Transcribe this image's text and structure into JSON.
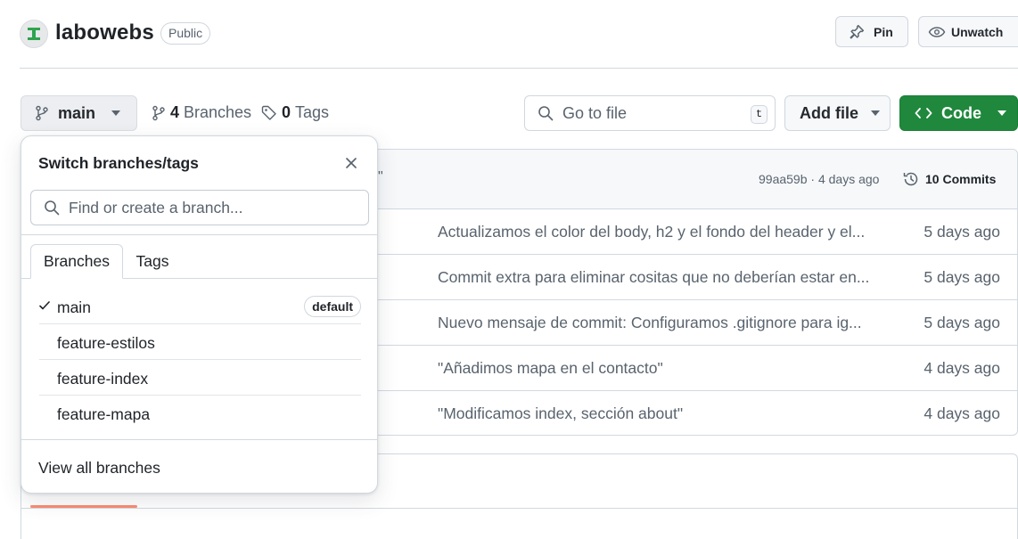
{
  "repo": {
    "name": "labowebs",
    "visibility": "Public",
    "pin_label": "Pin",
    "watch_label": "Unwatch"
  },
  "toolbar": {
    "branch": "main",
    "branches_count": "4",
    "branches_label": "Branches",
    "tags_count": "0",
    "tags_label": "Tags",
    "goto_placeholder": "Go to file",
    "goto_shortcut": "t",
    "add_file_label": "Add file",
    "code_label": "Code"
  },
  "latest_commit": {
    "quote_fragment": "\"",
    "meta": "99aa59b · 4 days ago",
    "commits_label": "10 Commits"
  },
  "files": [
    {
      "message": "Actualizamos el color del body, h2 y el fondo del header y el...",
      "time": "5 days ago"
    },
    {
      "message": "Commit extra para eliminar cositas que no deberían estar en...",
      "time": "5 days ago"
    },
    {
      "message": "Nuevo mensaje de commit: Configuramos .gitignore para ig...",
      "time": "5 days ago"
    },
    {
      "message": "\"Añadimos mapa en el contacto\"",
      "time": "4 days ago"
    },
    {
      "message": "\"Modificamos index, sección about\"",
      "time": "4 days ago"
    }
  ],
  "dropdown": {
    "title": "Switch branches/tags",
    "search_placeholder": "Find or create a branch...",
    "tabs": [
      {
        "label": "Branches"
      },
      {
        "label": "Tags"
      }
    ],
    "branches": [
      {
        "name": "main",
        "badge": "default",
        "selected": true
      },
      {
        "name": "feature-estilos"
      },
      {
        "name": "feature-index"
      },
      {
        "name": "feature-mapa"
      }
    ],
    "footer": "View all branches"
  },
  "colors": {
    "accent_green": "#1f883d",
    "readme_tab_indicator": "#fd8c73"
  }
}
